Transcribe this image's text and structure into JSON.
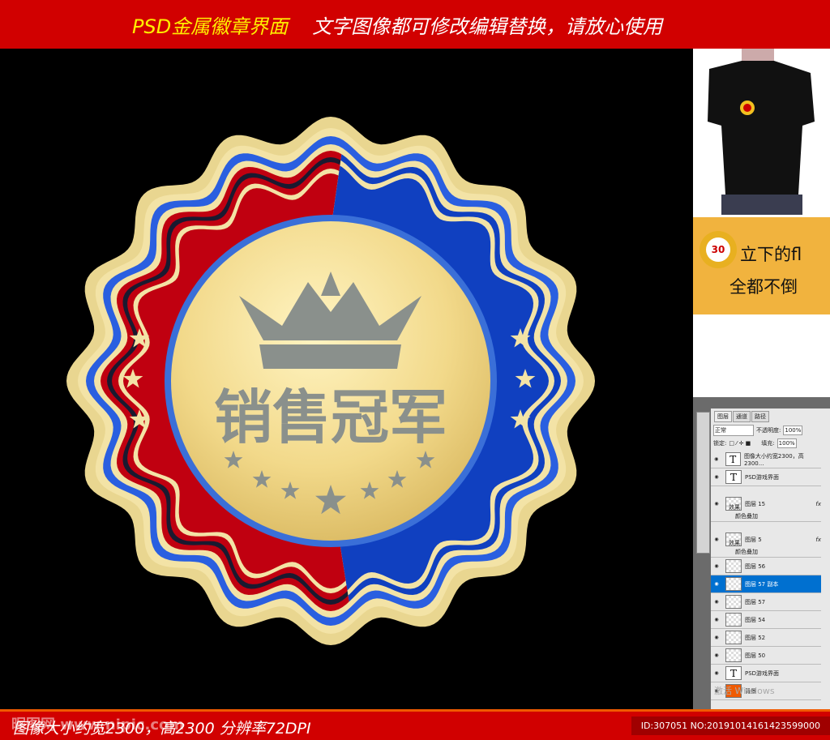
{
  "header": {
    "title": "PSD金属徽章界面",
    "subtitle": "文字图像都可修改编辑替换，请放心使用"
  },
  "badge": {
    "text": "销售冠军",
    "colors": {
      "red": "#c00010",
      "blue": "#1040c0",
      "gold": "#f2d98a",
      "cream": "#f3e3a6",
      "gray": "#8a908c"
    }
  },
  "banner": {
    "line1": "立下的fl",
    "line2": "全都不倒"
  },
  "photoshop": {
    "tabs": [
      "图层",
      "通道",
      "路径"
    ],
    "blend_mode": "正常",
    "opacity_label": "不透明度:",
    "opacity": "100%",
    "lock_label": "锁定:",
    "fill_label": "填充:",
    "fill": "100%",
    "layers": [
      {
        "name": "图像大小约宽2300，高2300...",
        "type": "T"
      },
      {
        "name": "PSD游戏界面",
        "type": "T"
      },
      {
        "name": "图层 15",
        "fx": "fx",
        "effects": [
          "效果",
          "颜色叠加"
        ]
      },
      {
        "name": "图层 5",
        "fx": "fx",
        "effects": [
          "效果",
          "颜色叠加"
        ]
      },
      {
        "name": "图层 56"
      },
      {
        "name": "图层 57 副本",
        "selected": true
      },
      {
        "name": "图层 57"
      },
      {
        "name": "图层 54"
      },
      {
        "name": "图层 52"
      },
      {
        "name": "图层 50"
      },
      {
        "name": "PSD游戏界面",
        "type": "T"
      },
      {
        "name": "背景"
      }
    ],
    "activation": "激活 Windows"
  },
  "footer": {
    "info": "图像大小约宽2300，高2300    分辨率72DPI",
    "watermark": "昵图网 www.nipic.com",
    "id": "ID:307051 NO:20191014161423599000"
  }
}
